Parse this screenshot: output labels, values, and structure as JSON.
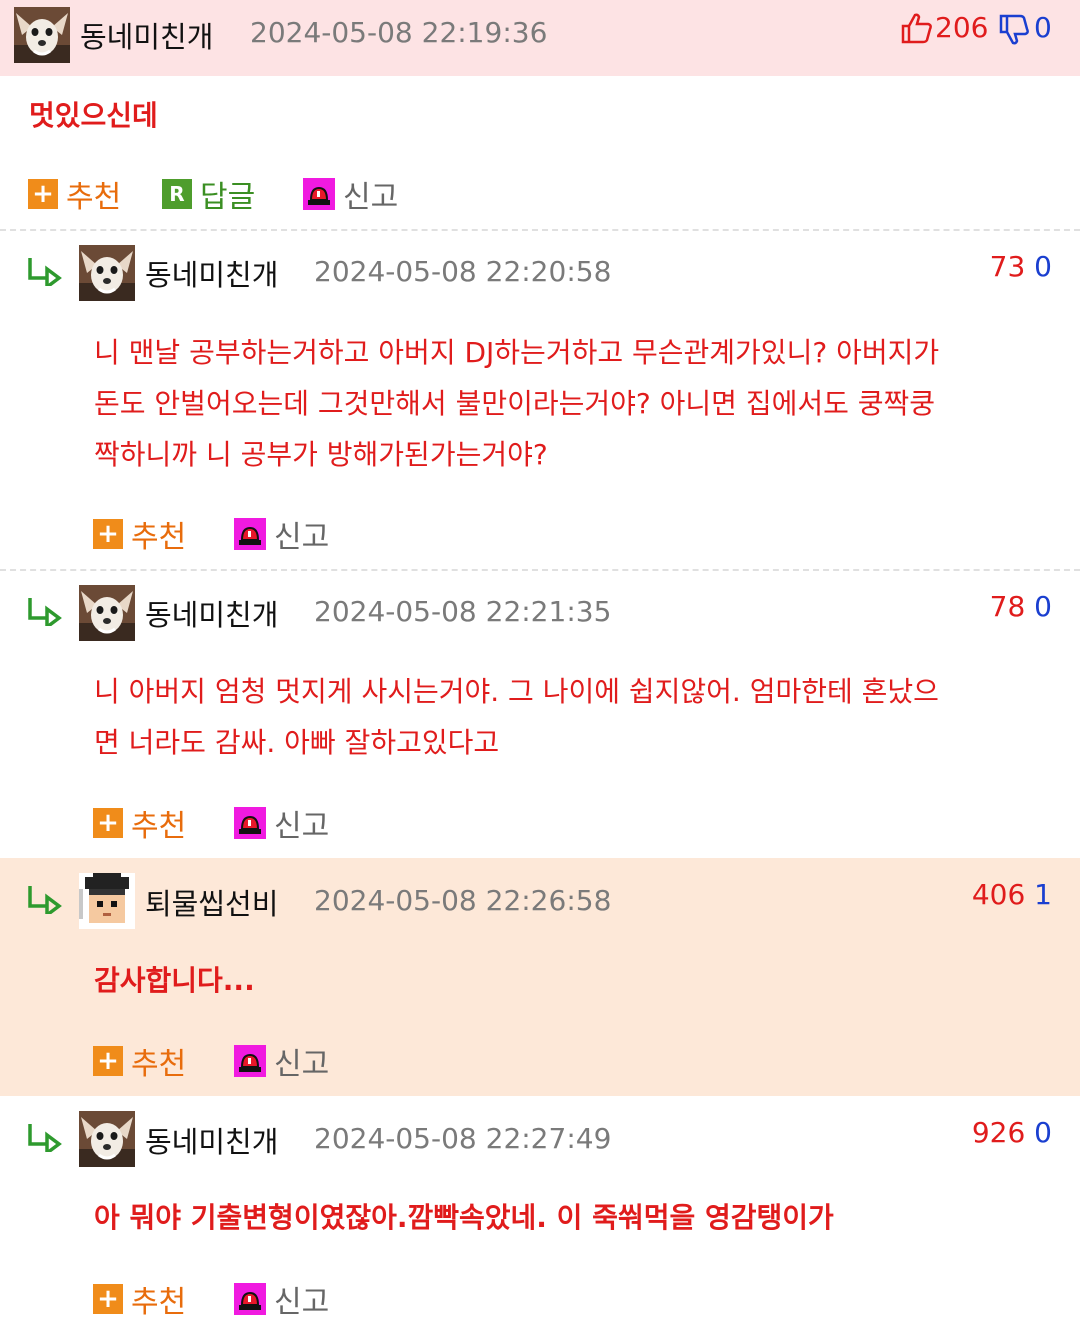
{
  "comments": [
    {
      "nickname": "동네미친개",
      "datetime": "2024-05-08 22:19:36",
      "likes": "206",
      "dislikes": "0",
      "body": [
        "멋있으신데"
      ],
      "actions": {
        "recommend": "추천",
        "reply": "답글",
        "report": "신고"
      }
    },
    {
      "nickname": "동네미친개",
      "datetime": "2024-05-08 22:20:58",
      "likes": "73",
      "dislikes": "0",
      "body": [
        "니 맨날 공부하는거하고 아버지 DJ하는거하고 무슨관계가있니? 아버지가",
        "돈도 안벌어오는데 그것만해서 불만이라는거야? 아니면 집에서도 쿵짝쿵",
        "짝하니까 니 공부가 방해가된가는거야?"
      ],
      "actions": {
        "recommend": "추천",
        "report": "신고"
      }
    },
    {
      "nickname": "동네미친개",
      "datetime": "2024-05-08 22:21:35",
      "likes": "78",
      "dislikes": "0",
      "body": [
        "니 아버지 엄청 멋지게 사시는거야. 그 나이에 쉽지않어. 엄마한테 혼났으",
        "면 너라도 감싸. 아빠 잘하고있다고"
      ],
      "actions": {
        "recommend": "추천",
        "report": "신고"
      }
    },
    {
      "nickname": "퇴물씹선비",
      "datetime": "2024-05-08 22:26:58",
      "likes": "406",
      "dislikes": "1",
      "body": [
        "감사합니다..."
      ],
      "actions": {
        "recommend": "추천",
        "report": "신고"
      }
    },
    {
      "nickname": "동네미친개",
      "datetime": "2024-05-08 22:27:49",
      "likes": "926",
      "dislikes": "0",
      "body": [
        "아 뭐야 기출변형이였잖아.깜빡속았네. 이 죽쒀먹을 영감탱이가"
      ],
      "actions": {
        "recommend": "추천",
        "report": "신고"
      }
    }
  ],
  "colors": {
    "top_bg": "#fde3e4",
    "author_reply_bg": "#fde8d8",
    "body_text": "#e01c1c",
    "like": "#e01c1c",
    "dislike": "#1a3fd0"
  },
  "icons": [
    "dog-avatar",
    "scholar-avatar",
    "thumbs-up-icon",
    "thumbs-down-icon",
    "reply-arrow-icon",
    "plus-icon",
    "r-icon",
    "siren-icon"
  ]
}
